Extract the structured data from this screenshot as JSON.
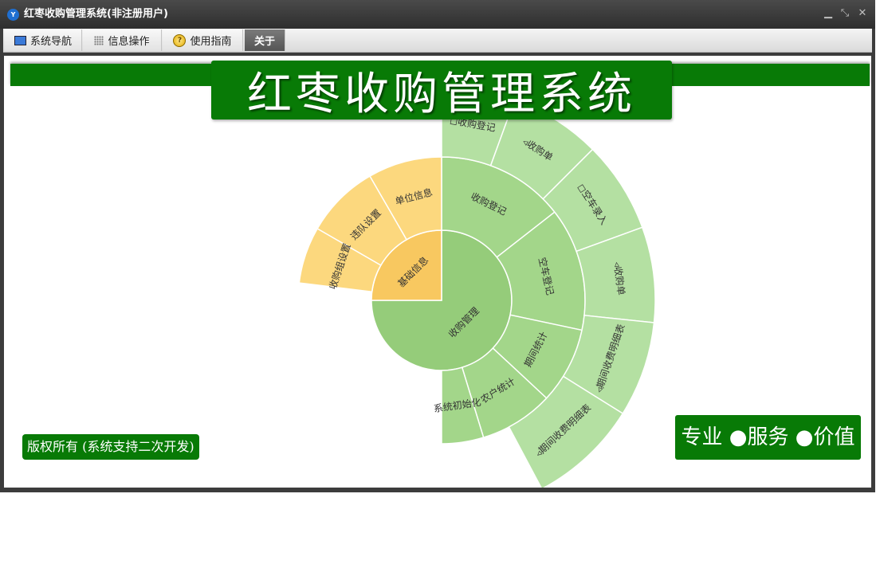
{
  "window": {
    "title": "红枣收购管理系统(非注册用户)",
    "app_icon_label": "Y",
    "controls": {
      "minimize": "▁",
      "restore": "⤡",
      "close": "✕"
    }
  },
  "menu": {
    "tabs": [
      {
        "label": "系统导航",
        "icon": "monitor-icon"
      },
      {
        "label": "信息操作",
        "icon": "grid-icon"
      },
      {
        "label": "使用指南",
        "icon": "help-icon"
      },
      {
        "label": "关于",
        "icon": "",
        "active": true
      }
    ]
  },
  "content": {
    "system_title": "红枣收购管理系统",
    "copyright": "版权所有 (系统支持二次开发)",
    "slogan": "专业 ●服务 ●价值"
  },
  "colors": {
    "brand_green": "#087a06",
    "core_green": "#95cc7a",
    "ring_green": "#a3d68a",
    "outer_green": "#b4e0a2",
    "core_orange": "#f8c860",
    "outer_orange": "#fcd87e"
  },
  "sunburst": {
    "core": [
      {
        "label": "收购管理",
        "color": "#95cc7a"
      },
      {
        "label": "基础信息",
        "color": "#f8c860"
      }
    ],
    "ring": [
      {
        "label": "收购登记",
        "color": "#a3d68a"
      },
      {
        "label": "空车登记",
        "color": "#a3d68a"
      },
      {
        "label": "期间统计",
        "color": "#a3d68a"
      },
      {
        "label": "农户统计",
        "color": "#a3d68a"
      },
      {
        "label": "系统初始化",
        "color": "#a3d68a"
      },
      {
        "label": "单位信息",
        "color": "#fcd87e"
      },
      {
        "label": "违队设置",
        "color": "#fcd87e"
      },
      {
        "label": "收购组设置",
        "color": "#fcd87e"
      }
    ],
    "outer": [
      {
        "label": "◻收购登记",
        "color": "#b4e0a2"
      },
      {
        "label": "◃收购单",
        "color": "#b4e0a2"
      },
      {
        "label": "◻空车录入",
        "color": "#b4e0a2"
      },
      {
        "label": "◃收购单",
        "color": "#b4e0a2"
      },
      {
        "label": "◃期间收费明细表",
        "color": "#b4e0a2"
      },
      {
        "label": "◃期间收费明细表",
        "color": "#b4e0a2"
      }
    ]
  }
}
